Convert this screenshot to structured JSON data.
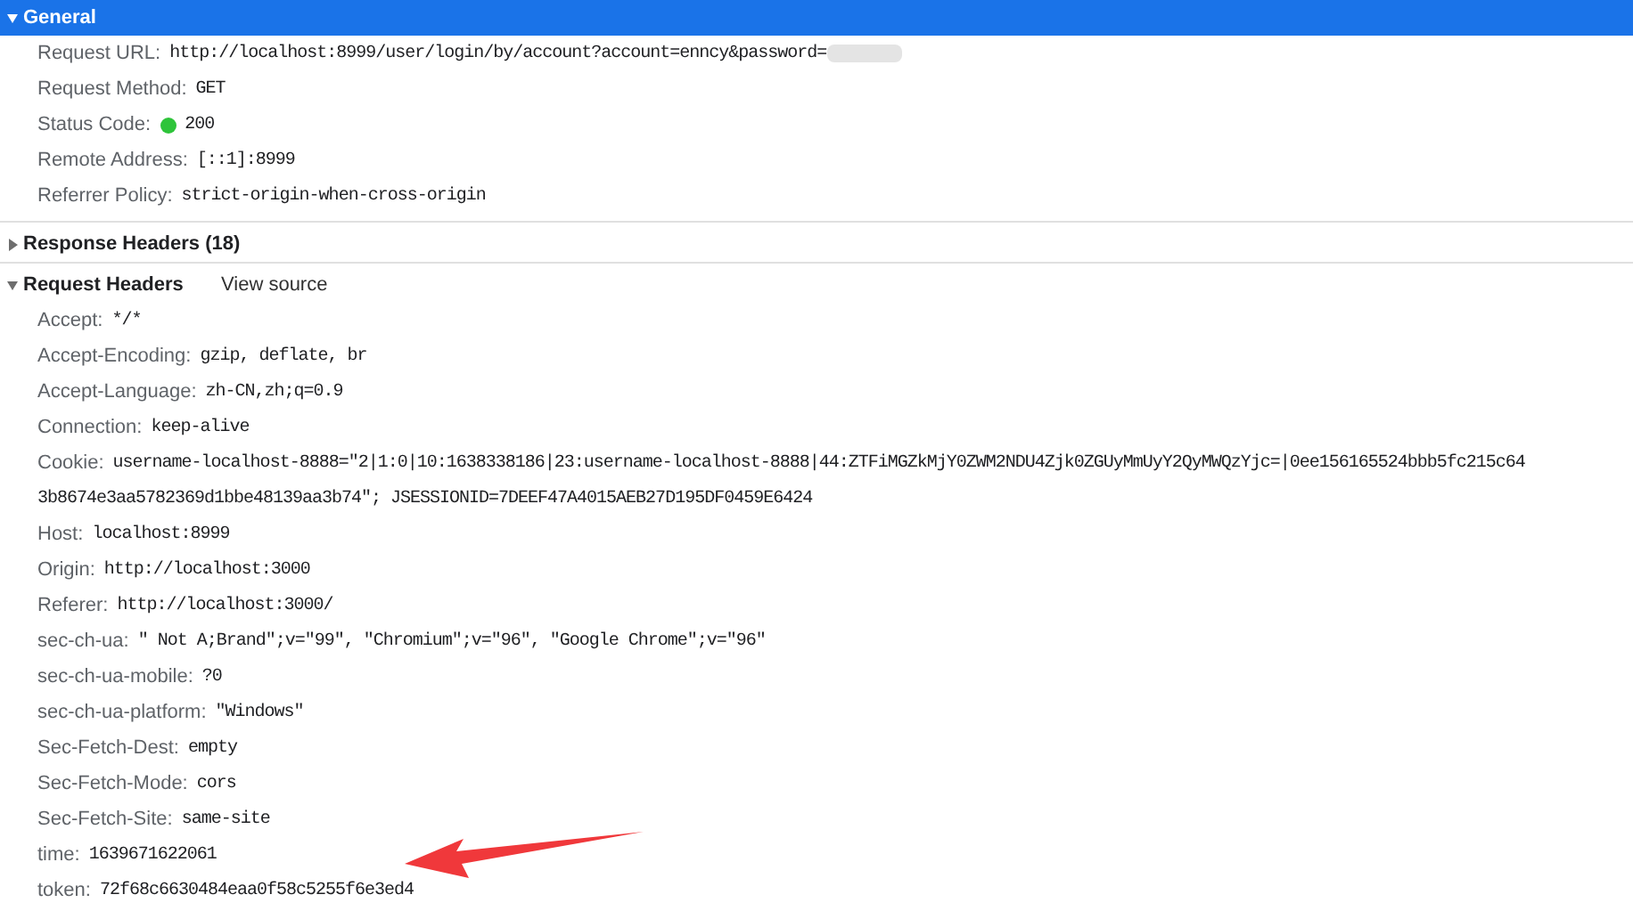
{
  "sections": [
    {
      "title": "General",
      "expanded": true,
      "selected": true,
      "rows": [
        {
          "label": "Request URL:",
          "value": "http://localhost:8999/user/login/by/account?account=enncy&password=",
          "redacted": true
        },
        {
          "label": "Request Method:",
          "value": "GET"
        },
        {
          "label": "Status Code:",
          "value": "200",
          "color": "#2ec43a"
        },
        {
          "label": "Remote Address:",
          "value": "[::1]:8999"
        },
        {
          "label": "Referrer Policy:",
          "value": "strict-origin-when-cross-origin"
        }
      ]
    },
    {
      "title": "Response Headers (18)",
      "expanded": false,
      "selected": false
    },
    {
      "title": "Request Headers",
      "link": "View source",
      "expanded": true,
      "selected": false,
      "rows": [
        {
          "label": "Accept:",
          "value": "*/*"
        },
        {
          "label": "Accept-Encoding:",
          "value": "gzip, deflate, br"
        },
        {
          "label": "Accept-Language:",
          "value": "zh-CN,zh;q=0.9"
        },
        {
          "label": "Connection:",
          "value": "keep-alive"
        },
        {
          "label": "Cookie:",
          "value": "username-localhost-8888=\"2|1:0|10:1638338186|23:username-localhost-8888|44:ZTFiMGZkMjY0ZWM2NDU4Zjk0ZGUyMmUyY2QyMWQzYjc=|0ee156165524bbb5fc215c64",
          "continuation": "3b8674e3aa5782369d1bbe48139aa3b74\"; JSESSIONID=7DEEF47A4015AEB27D195DF0459E6424"
        },
        {
          "label": "Host:",
          "value": "localhost:8999"
        },
        {
          "label": "Origin:",
          "value": "http://localhost:3000"
        },
        {
          "label": "Referer:",
          "value": "http://localhost:3000/"
        },
        {
          "label": "sec-ch-ua:",
          "value": "\" Not A;Brand\";v=\"99\", \"Chromium\";v=\"96\", \"Google Chrome\";v=\"96\""
        },
        {
          "label": "sec-ch-ua-mobile:",
          "value": "?0"
        },
        {
          "label": "sec-ch-ua-platform:",
          "value": "\"Windows\""
        },
        {
          "label": "Sec-Fetch-Dest:",
          "value": "empty"
        },
        {
          "label": "Sec-Fetch-Mode:",
          "value": "cors"
        },
        {
          "label": "Sec-Fetch-Site:",
          "value": "same-site"
        },
        {
          "label": "time:",
          "value": "1639671622061"
        },
        {
          "label": "token:",
          "value": "72f68c6630484eaa0f58c5255f6e3ed4"
        }
      ]
    }
  ]
}
